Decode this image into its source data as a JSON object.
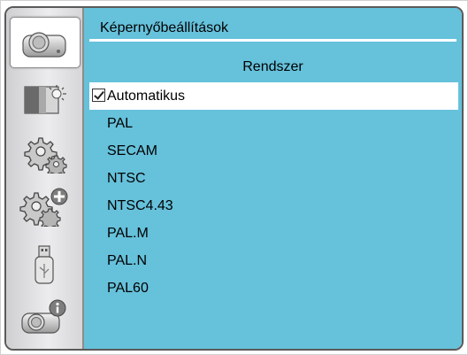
{
  "colors": {
    "content_bg": "#66c1db",
    "sidebar_bg": "#e4e4e6",
    "selected_bg": "#ffffff",
    "frame_border": "#5a5a5a"
  },
  "sidebar": {
    "items": [
      {
        "icon": "projector-icon",
        "active": true
      },
      {
        "icon": "picture-brightness-icon",
        "active": false
      },
      {
        "icon": "settings-gear-icon",
        "active": false
      },
      {
        "icon": "advanced-settings-gear-plus-icon",
        "active": false
      },
      {
        "icon": "usb-icon",
        "active": false
      },
      {
        "icon": "projector-info-icon",
        "active": false
      }
    ]
  },
  "header": {
    "title": "Képernyőbeállítások"
  },
  "section": {
    "title": "Rendszer"
  },
  "menu": {
    "items": [
      {
        "label": "Automatikus",
        "checked": true,
        "selected": true
      },
      {
        "label": "PAL",
        "checked": false,
        "selected": false
      },
      {
        "label": "SECAM",
        "checked": false,
        "selected": false
      },
      {
        "label": "NTSC",
        "checked": false,
        "selected": false
      },
      {
        "label": "NTSC4.43",
        "checked": false,
        "selected": false
      },
      {
        "label": "PAL.M",
        "checked": false,
        "selected": false
      },
      {
        "label": "PAL.N",
        "checked": false,
        "selected": false
      },
      {
        "label": "PAL60",
        "checked": false,
        "selected": false
      }
    ]
  }
}
